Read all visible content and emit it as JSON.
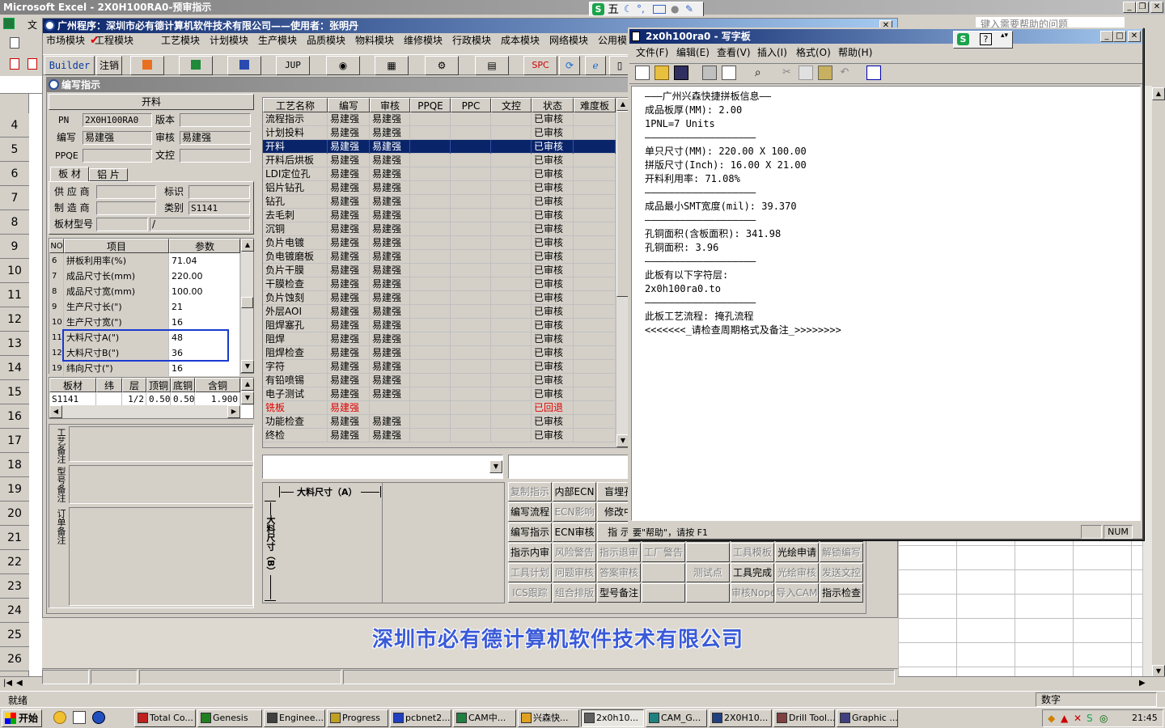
{
  "excel": {
    "title": "Microsoft Excel - 2X0H100RA0-预审指示",
    "help_box": "键入需要帮助的问题",
    "menu_first": "文",
    "row_numbers": [
      "4",
      "5",
      "6",
      "7",
      "8",
      "9",
      "10",
      "11",
      "12",
      "13",
      "14",
      "15",
      "16",
      "17",
      "18",
      "19",
      "20",
      "21",
      "22",
      "23",
      "24",
      "25",
      "26"
    ],
    "status_left": "就绪",
    "status_right": "数字"
  },
  "ime": {
    "label": "五"
  },
  "app": {
    "title": "广州程序：深圳市必有德计算机软件技术有限公司——使用者：张明丹",
    "modules": [
      "市场模块",
      "工程模块",
      "工艺模块",
      "计划模块",
      "生产模块",
      "品质模块",
      "物料模块",
      "维修模块",
      "行政模块",
      "成本模块",
      "网络模块",
      "公用模"
    ],
    "toolbar": [
      "Builder",
      "注销",
      "JUP",
      "SPC"
    ],
    "company_banner": "深圳市必有德计算机软件技术有限公司"
  },
  "editor": {
    "title": "编写指示",
    "section": "开料",
    "pn_label": "PN",
    "pn_value": "2X0H100RA0",
    "version_label": "版本",
    "writer_label": "编写",
    "writer_value": "易建强",
    "reviewer_label": "审核",
    "reviewer_value": "易建强",
    "ppqe_label": "PPQE",
    "doc_control_label": "文控",
    "tabs": [
      "板 材",
      "铝 片"
    ],
    "supplier_label": "供 应 商",
    "mark_label": "标识",
    "maker_label": "制 造 商",
    "category_label": "类别",
    "category_value": "S1141",
    "model_label": "板材型号",
    "model_value": "/",
    "param_headers": [
      "NO",
      "项目",
      "参数"
    ],
    "params": [
      [
        "6",
        "拼板利用率(%)",
        "71.04"
      ],
      [
        "7",
        "成品尺寸长(mm)",
        "220.00"
      ],
      [
        "8",
        "成品尺寸宽(mm)",
        "100.00"
      ],
      [
        "9",
        "生产尺寸长(\")",
        "21"
      ],
      [
        "10",
        "生产尺寸宽(\")",
        "16"
      ],
      [
        "11",
        "大料尺寸A(\")",
        "48"
      ],
      [
        "12",
        "大料尺寸B(\")",
        "36"
      ],
      [
        "19",
        "纬向尺寸(\")",
        "16"
      ]
    ],
    "mat_headers": [
      "板材",
      "纬",
      "层",
      "顶铜",
      "底铜",
      "含铜"
    ],
    "mat_row": [
      "S1141",
      "",
      "1/2",
      "0.50",
      "0.50",
      "1.900"
    ],
    "note_labels": [
      "工艺备注",
      "型号备注",
      "订单备注"
    ],
    "diagram_a": "大料尺寸（A）",
    "diagram_b": "大料尺寸（B）"
  },
  "process": {
    "headers": [
      "工艺名称",
      "编写",
      "审核",
      "PPQE",
      "PPC",
      "文控",
      "状态",
      "难度板"
    ],
    "rows": [
      [
        "流程指示",
        "易建强",
        "易建强",
        "",
        "",
        "",
        "已审核",
        ""
      ],
      [
        "计划投料",
        "易建强",
        "易建强",
        "",
        "",
        "",
        "已审核",
        ""
      ],
      [
        "开料",
        "易建强",
        "易建强",
        "",
        "",
        "",
        "已审核",
        ""
      ],
      [
        "开料后烘板",
        "易建强",
        "易建强",
        "",
        "",
        "",
        "已审核",
        ""
      ],
      [
        "LDI定位孔",
        "易建强",
        "易建强",
        "",
        "",
        "",
        "已审核",
        ""
      ],
      [
        "铝片钻孔",
        "易建强",
        "易建强",
        "",
        "",
        "",
        "已审核",
        ""
      ],
      [
        "钻孔",
        "易建强",
        "易建强",
        "",
        "",
        "",
        "已审核",
        ""
      ],
      [
        "去毛刺",
        "易建强",
        "易建强",
        "",
        "",
        "",
        "已审核",
        ""
      ],
      [
        "沉铜",
        "易建强",
        "易建强",
        "",
        "",
        "",
        "已审核",
        ""
      ],
      [
        "负片电镀",
        "易建强",
        "易建强",
        "",
        "",
        "",
        "已审核",
        ""
      ],
      [
        "负电镀磨板",
        "易建强",
        "易建强",
        "",
        "",
        "",
        "已审核",
        ""
      ],
      [
        "负片干膜",
        "易建强",
        "易建强",
        "",
        "",
        "",
        "已审核",
        ""
      ],
      [
        "干膜检查",
        "易建强",
        "易建强",
        "",
        "",
        "",
        "已审核",
        ""
      ],
      [
        "负片蚀刻",
        "易建强",
        "易建强",
        "",
        "",
        "",
        "已审核",
        ""
      ],
      [
        "外层AOI",
        "易建强",
        "易建强",
        "",
        "",
        "",
        "已审核",
        ""
      ],
      [
        "阻焊塞孔",
        "易建强",
        "易建强",
        "",
        "",
        "",
        "已审核",
        ""
      ],
      [
        "阻焊",
        "易建强",
        "易建强",
        "",
        "",
        "",
        "已审核",
        ""
      ],
      [
        "阻焊检查",
        "易建强",
        "易建强",
        "",
        "",
        "",
        "已审核",
        ""
      ],
      [
        "字符",
        "易建强",
        "易建强",
        "",
        "",
        "",
        "已审核",
        ""
      ],
      [
        "有铅喷锡",
        "易建强",
        "易建强",
        "",
        "",
        "",
        "已审核",
        ""
      ],
      [
        "电子测试",
        "易建强",
        "易建强",
        "",
        "",
        "",
        "已审核",
        ""
      ],
      [
        "铣板",
        "易建强",
        "",
        "",
        "",
        "",
        "已回退",
        ""
      ],
      [
        "功能检查",
        "易建强",
        "易建强",
        "",
        "",
        "",
        "已审核",
        ""
      ],
      [
        "终检",
        "易建强",
        "易建强",
        "",
        "",
        "",
        "已审核",
        ""
      ]
    ],
    "selected_index": 2,
    "rejected_index": 21
  },
  "buttons": [
    [
      "复制指示",
      "内部ECN",
      "盲埋孔",
      "",
      "",
      "",
      "",
      "",
      ""
    ],
    [
      "编写流程",
      "ECN影响",
      "修改中",
      "",
      "",
      "",
      "",
      "",
      ""
    ],
    [
      "编写指示",
      "ECN审核",
      "指 示",
      "",
      "",
      "",
      "",
      "",
      ""
    ],
    [
      "指示内审",
      "风险警告",
      "指示退审",
      "工厂警告",
      "",
      "工具模板",
      "光绘申请",
      "解锁编写",
      ""
    ],
    [
      "工具计划",
      "问题审核",
      "答案审核",
      "",
      "测试点",
      "工具完成",
      "光绘审核",
      "发送文控",
      ""
    ],
    [
      "ICS跟踪",
      "组合排版",
      "型号备注",
      "",
      "",
      "审核Nope",
      "导入CAM",
      "指示检查",
      ""
    ]
  ],
  "wordpad": {
    "title": "2x0h100ra0 - 写字板",
    "menu": [
      "文件(F)",
      "编辑(E)",
      "查看(V)",
      "插入(I)",
      "格式(O)",
      "帮助(H)"
    ],
    "lines": [
      "———广州兴森快捷拼板信息——",
      "成品板厚(MM): 2.00",
      "1PNL=7 Units",
      "———————————————————",
      "单只尺寸(MM): 220.00 X 100.00",
      "拼版尺寸(Inch): 16.00 X 21.00",
      "开料利用率: 71.08%",
      "———————————————————",
      "成品最小SMT宽度(mil): 39.370",
      "———————————————————",
      "孔铜面积(含板面积): 341.98",
      "孔铜面积: 3.96",
      "———————————————————",
      "此板有以下字符层:",
      "2x0h100ra0.to",
      "———————————————————",
      "此板工艺流程: 掩孔流程",
      "<<<<<<<_请检查周期格式及备注_>>>>>>>>"
    ],
    "status_help": "要\"帮助\"，请按 F1",
    "status_num": "NUM"
  },
  "taskbar": {
    "start": "开始",
    "items": [
      "Total Co...",
      "Genesis",
      "Enginee...",
      "Progress",
      "pcbnet2...",
      "CAM中...",
      "兴森快...",
      "2x0h10...",
      "CAM_G...",
      "2X0H10...",
      "Drill Tool...",
      "Graphic ..."
    ],
    "active_index": 7,
    "clock": "21:45"
  }
}
